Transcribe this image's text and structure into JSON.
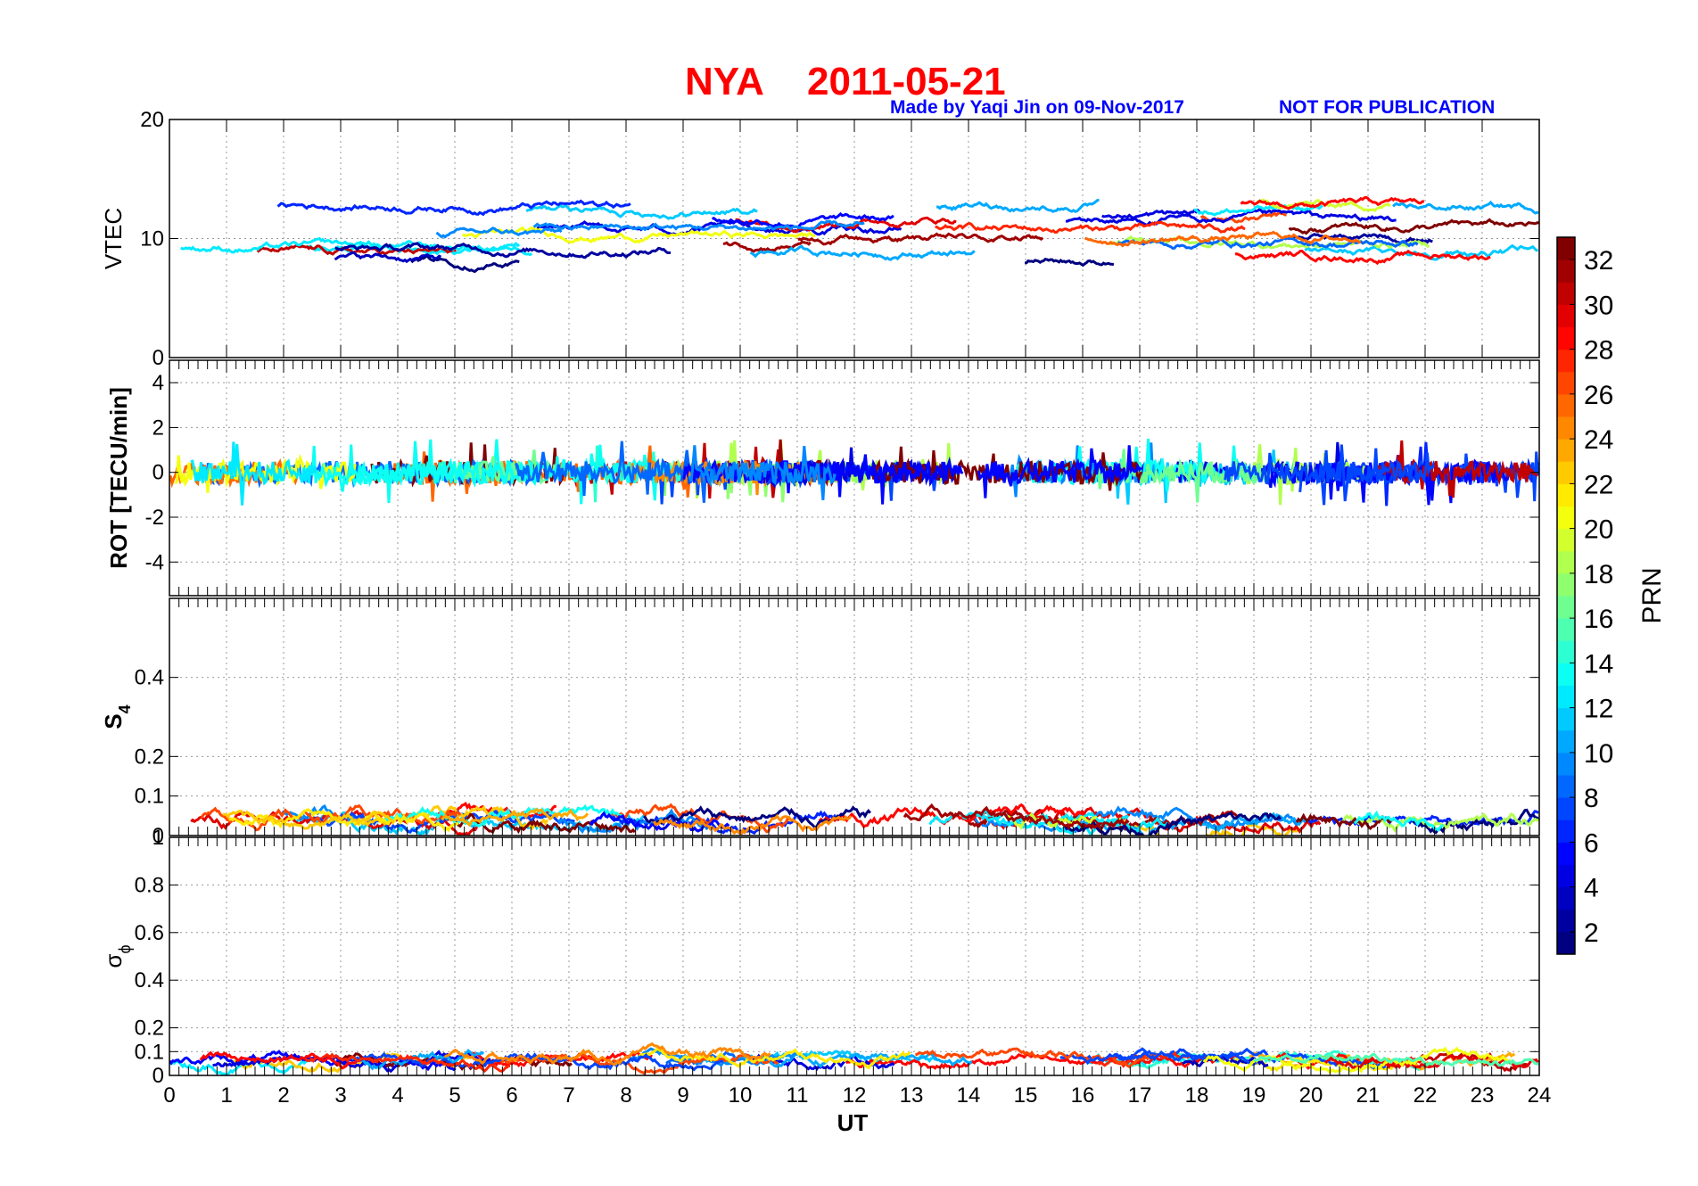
{
  "figure": {
    "title_station": "NYA",
    "title_date": "2011-05-21",
    "made_by": "Made by Yaqi Jin on 09-Nov-2017",
    "notice": "NOT FOR PUBLICATION"
  },
  "chart_data": [
    {
      "id": "vtec",
      "type": "line",
      "ylabel": "VTEC",
      "ylim": [
        0,
        20
      ],
      "yticks": [
        "0",
        "10",
        "20"
      ],
      "ytick_values": [
        0,
        10,
        20
      ],
      "xlim": [
        0,
        24
      ],
      "grid": true
    },
    {
      "id": "rot",
      "type": "line",
      "ylabel": "ROT [TECU/min]",
      "ylim": [
        -5.5,
        5
      ],
      "yticks": [
        "-4",
        "-2",
        "0",
        "2",
        "4"
      ],
      "ytick_values": [
        -4,
        -2,
        0,
        2,
        4
      ],
      "xlim": [
        0,
        24
      ],
      "grid": true
    },
    {
      "id": "s4",
      "type": "line",
      "ylabel_main": "S",
      "ylabel_sub": "4",
      "ylim": [
        0,
        0.6
      ],
      "yticks": [
        "0",
        "0.1",
        "0.2",
        "0.4"
      ],
      "ytick_values": [
        0,
        0.1,
        0.2,
        0.4
      ],
      "xlim": [
        0,
        24
      ],
      "grid": true
    },
    {
      "id": "sigphi",
      "type": "line",
      "ylabel_main": "σ",
      "ylabel_sub": "ϕ",
      "ylim": [
        0,
        1
      ],
      "yticks": [
        "0",
        "0.1",
        "0.2",
        "0.4",
        "0.6",
        "0.8",
        "1"
      ],
      "ytick_values": [
        0,
        0.1,
        0.2,
        0.4,
        0.6,
        0.8,
        1
      ],
      "xlim": [
        0,
        24
      ],
      "xlabel": "UT",
      "xticks": [
        "0",
        "1",
        "2",
        "3",
        "4",
        "5",
        "6",
        "7",
        "8",
        "9",
        "10",
        "11",
        "12",
        "13",
        "14",
        "15",
        "16",
        "17",
        "18",
        "19",
        "20",
        "21",
        "22",
        "23",
        "24"
      ],
      "grid": true
    }
  ],
  "colorbar": {
    "label": "PRN",
    "range": [
      1,
      33
    ],
    "ticks": [
      "2",
      "4",
      "6",
      "8",
      "10",
      "12",
      "14",
      "16",
      "18",
      "20",
      "22",
      "24",
      "26",
      "28",
      "30",
      "32"
    ],
    "tick_values": [
      2,
      4,
      6,
      8,
      10,
      12,
      14,
      16,
      18,
      20,
      22,
      24,
      26,
      28,
      30,
      32
    ],
    "colormap": "jet",
    "levels": 32
  }
}
